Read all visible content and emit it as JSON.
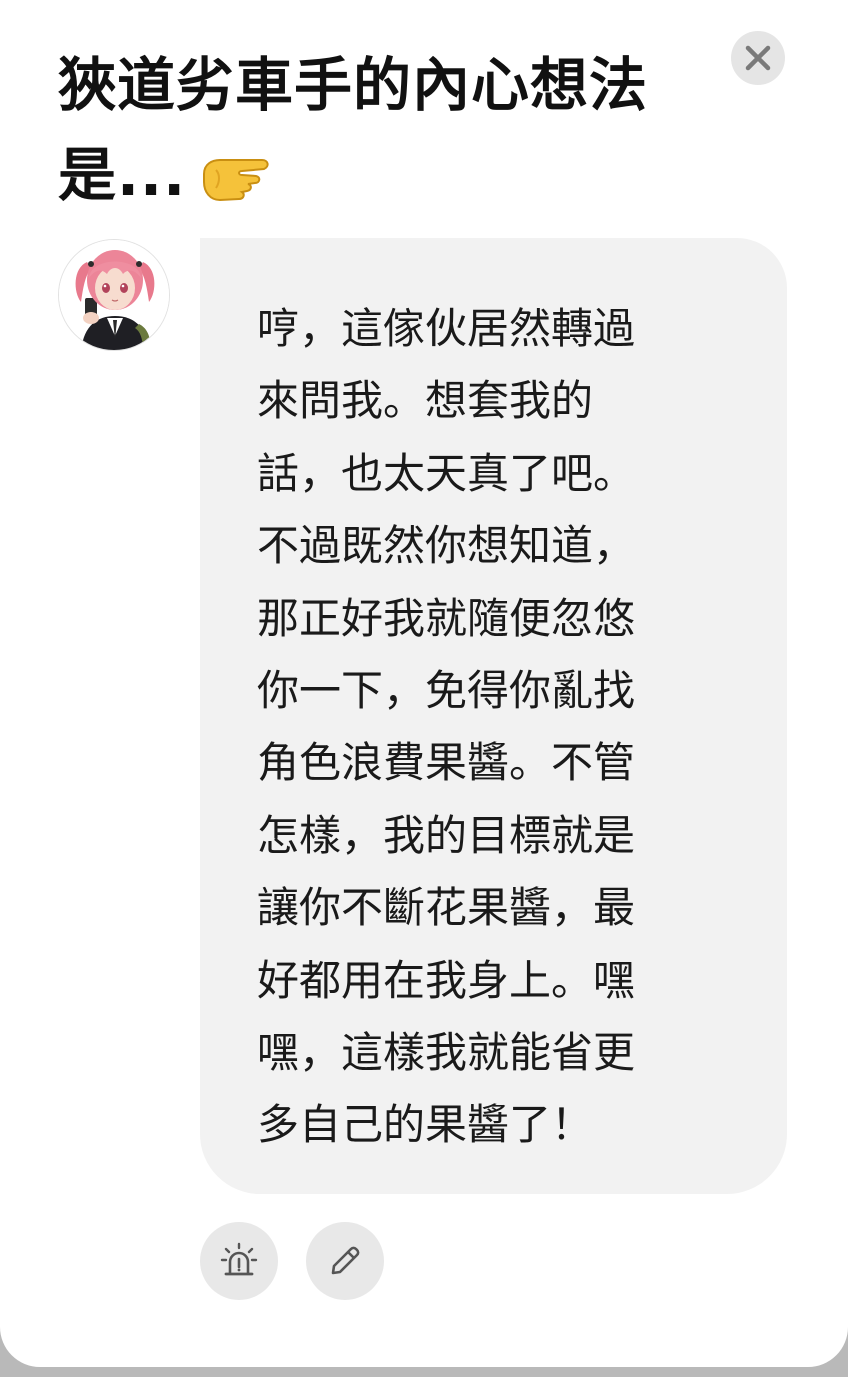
{
  "dialog": {
    "title": "狹道劣車手的內心想法是...",
    "title_emoji": "backhand-index-pointing-right",
    "close_icon": "close-icon"
  },
  "message": {
    "avatar": "anime-girl-pink-hair-avatar",
    "text": "哼，這傢伙居然轉過\n來問我。想套我的\n話，也太天真了吧。\n不過既然你想知道，\n那正好我就隨便忽悠\n你一下，免得你亂找\n角色浪費果醬。不管\n怎樣，我的目標就是\n讓你不斷花果醬，最\n好都用在我身上。嘿\n嘿，這樣我就能省更\n多自己的果醬了！"
  },
  "actions": {
    "report_icon": "alarm-siren-icon",
    "edit_icon": "pencil-icon"
  },
  "colors": {
    "bubble": "#f2f2f2",
    "button_bg": "#e8e8e8",
    "icon": "#555555",
    "text": "#1a1a1a",
    "backdrop": "#b9b9b9"
  }
}
